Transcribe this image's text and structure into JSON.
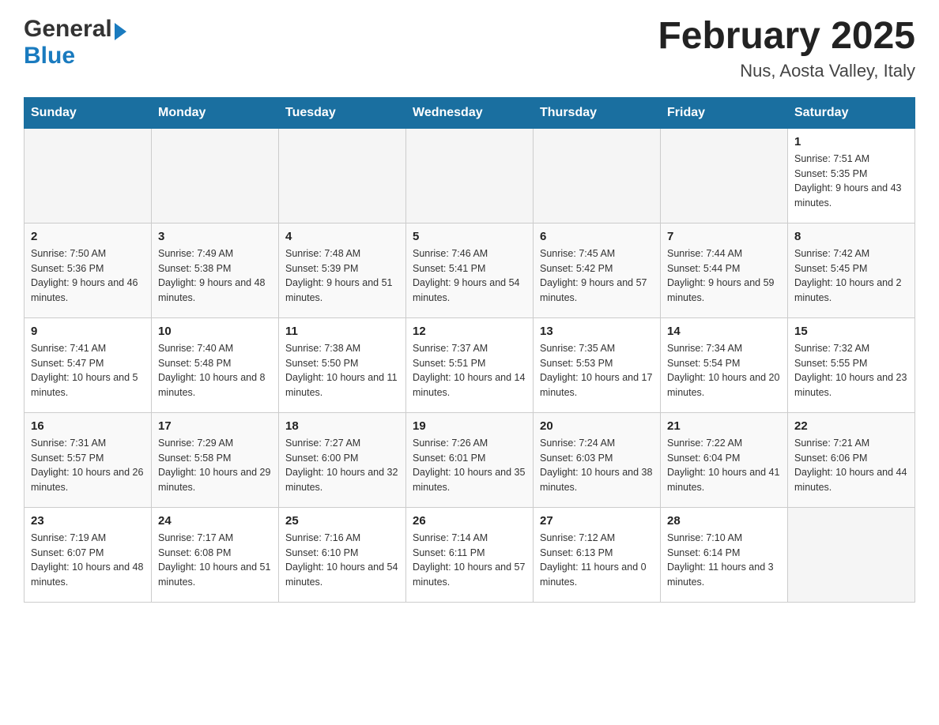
{
  "header": {
    "logo": {
      "general": "General",
      "blue": "Blue",
      "arrow_color": "#1a7bbf"
    },
    "title": "February 2025",
    "location": "Nus, Aosta Valley, Italy"
  },
  "days_of_week": [
    "Sunday",
    "Monday",
    "Tuesday",
    "Wednesday",
    "Thursday",
    "Friday",
    "Saturday"
  ],
  "weeks": [
    [
      {
        "day": "",
        "info": ""
      },
      {
        "day": "",
        "info": ""
      },
      {
        "day": "",
        "info": ""
      },
      {
        "day": "",
        "info": ""
      },
      {
        "day": "",
        "info": ""
      },
      {
        "day": "",
        "info": ""
      },
      {
        "day": "1",
        "info": "Sunrise: 7:51 AM\nSunset: 5:35 PM\nDaylight: 9 hours and 43 minutes."
      }
    ],
    [
      {
        "day": "2",
        "info": "Sunrise: 7:50 AM\nSunset: 5:36 PM\nDaylight: 9 hours and 46 minutes."
      },
      {
        "day": "3",
        "info": "Sunrise: 7:49 AM\nSunset: 5:38 PM\nDaylight: 9 hours and 48 minutes."
      },
      {
        "day": "4",
        "info": "Sunrise: 7:48 AM\nSunset: 5:39 PM\nDaylight: 9 hours and 51 minutes."
      },
      {
        "day": "5",
        "info": "Sunrise: 7:46 AM\nSunset: 5:41 PM\nDaylight: 9 hours and 54 minutes."
      },
      {
        "day": "6",
        "info": "Sunrise: 7:45 AM\nSunset: 5:42 PM\nDaylight: 9 hours and 57 minutes."
      },
      {
        "day": "7",
        "info": "Sunrise: 7:44 AM\nSunset: 5:44 PM\nDaylight: 9 hours and 59 minutes."
      },
      {
        "day": "8",
        "info": "Sunrise: 7:42 AM\nSunset: 5:45 PM\nDaylight: 10 hours and 2 minutes."
      }
    ],
    [
      {
        "day": "9",
        "info": "Sunrise: 7:41 AM\nSunset: 5:47 PM\nDaylight: 10 hours and 5 minutes."
      },
      {
        "day": "10",
        "info": "Sunrise: 7:40 AM\nSunset: 5:48 PM\nDaylight: 10 hours and 8 minutes."
      },
      {
        "day": "11",
        "info": "Sunrise: 7:38 AM\nSunset: 5:50 PM\nDaylight: 10 hours and 11 minutes."
      },
      {
        "day": "12",
        "info": "Sunrise: 7:37 AM\nSunset: 5:51 PM\nDaylight: 10 hours and 14 minutes."
      },
      {
        "day": "13",
        "info": "Sunrise: 7:35 AM\nSunset: 5:53 PM\nDaylight: 10 hours and 17 minutes."
      },
      {
        "day": "14",
        "info": "Sunrise: 7:34 AM\nSunset: 5:54 PM\nDaylight: 10 hours and 20 minutes."
      },
      {
        "day": "15",
        "info": "Sunrise: 7:32 AM\nSunset: 5:55 PM\nDaylight: 10 hours and 23 minutes."
      }
    ],
    [
      {
        "day": "16",
        "info": "Sunrise: 7:31 AM\nSunset: 5:57 PM\nDaylight: 10 hours and 26 minutes."
      },
      {
        "day": "17",
        "info": "Sunrise: 7:29 AM\nSunset: 5:58 PM\nDaylight: 10 hours and 29 minutes."
      },
      {
        "day": "18",
        "info": "Sunrise: 7:27 AM\nSunset: 6:00 PM\nDaylight: 10 hours and 32 minutes."
      },
      {
        "day": "19",
        "info": "Sunrise: 7:26 AM\nSunset: 6:01 PM\nDaylight: 10 hours and 35 minutes."
      },
      {
        "day": "20",
        "info": "Sunrise: 7:24 AM\nSunset: 6:03 PM\nDaylight: 10 hours and 38 minutes."
      },
      {
        "day": "21",
        "info": "Sunrise: 7:22 AM\nSunset: 6:04 PM\nDaylight: 10 hours and 41 minutes."
      },
      {
        "day": "22",
        "info": "Sunrise: 7:21 AM\nSunset: 6:06 PM\nDaylight: 10 hours and 44 minutes."
      }
    ],
    [
      {
        "day": "23",
        "info": "Sunrise: 7:19 AM\nSunset: 6:07 PM\nDaylight: 10 hours and 48 minutes."
      },
      {
        "day": "24",
        "info": "Sunrise: 7:17 AM\nSunset: 6:08 PM\nDaylight: 10 hours and 51 minutes."
      },
      {
        "day": "25",
        "info": "Sunrise: 7:16 AM\nSunset: 6:10 PM\nDaylight: 10 hours and 54 minutes."
      },
      {
        "day": "26",
        "info": "Sunrise: 7:14 AM\nSunset: 6:11 PM\nDaylight: 10 hours and 57 minutes."
      },
      {
        "day": "27",
        "info": "Sunrise: 7:12 AM\nSunset: 6:13 PM\nDaylight: 11 hours and 0 minutes."
      },
      {
        "day": "28",
        "info": "Sunrise: 7:10 AM\nSunset: 6:14 PM\nDaylight: 11 hours and 3 minutes."
      },
      {
        "day": "",
        "info": ""
      }
    ]
  ]
}
